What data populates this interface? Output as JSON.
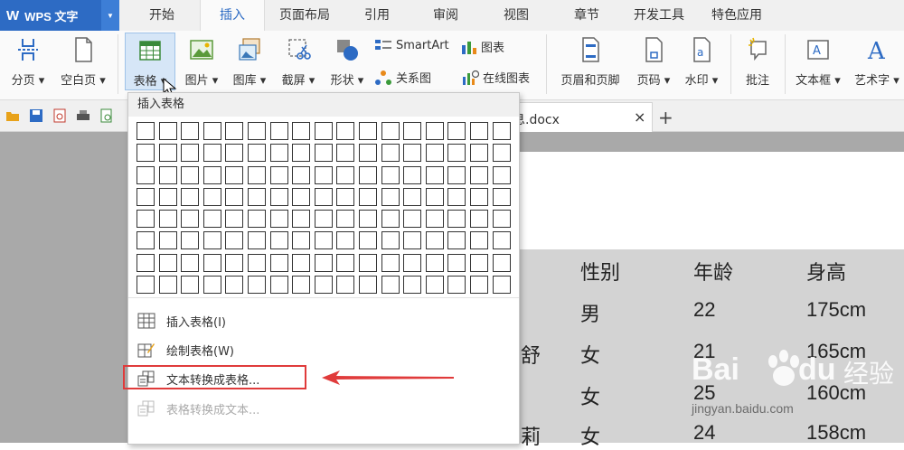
{
  "app": {
    "logo_letter": "W",
    "logo_text": "WPS 文字"
  },
  "tabs": [
    {
      "label": "开始"
    },
    {
      "label": "插入",
      "active": true
    },
    {
      "label": "页面布局"
    },
    {
      "label": "引用"
    },
    {
      "label": "审阅"
    },
    {
      "label": "视图"
    },
    {
      "label": "章节"
    },
    {
      "label": "开发工具"
    },
    {
      "label": "特色应用"
    }
  ],
  "ribbon": {
    "page_break": "分页",
    "blank_page": "空白页",
    "table": "表格",
    "picture": "图片",
    "gallery": "图库",
    "screenshot": "截屏",
    "shapes": "形状",
    "smartart": "SmartArt",
    "chart": "图表",
    "relation": "关系图",
    "online_chart": "在线图表",
    "header_footer": "页眉和页脚",
    "page_number": "页码",
    "watermark": "水印",
    "comment": "批注",
    "textbox": "文本框",
    "wordart": "艺术字"
  },
  "doc_tab": {
    "name": "息.docx",
    "close": "×",
    "add": "+"
  },
  "dropdown": {
    "header": "插入表格",
    "grid_cols": 17,
    "grid_rows": 8,
    "items": [
      {
        "label": "插入表格(I)",
        "disabled": false
      },
      {
        "label": "绘制表格(W)",
        "disabled": false
      },
      {
        "label": "文本转换成表格...",
        "disabled": false
      },
      {
        "label": "表格转换成文本...",
        "disabled": true
      }
    ]
  },
  "document": {
    "headers": [
      "性别",
      "年龄",
      "身高"
    ],
    "rows": [
      {
        "name": "",
        "gender": "男",
        "age": "22",
        "height": "175cm"
      },
      {
        "name": "舒",
        "gender": "女",
        "age": "21",
        "height": "165cm"
      },
      {
        "name": "",
        "gender": "女",
        "age": "25",
        "height": "160cm"
      },
      {
        "name": "莉",
        "gender": "女",
        "age": "24",
        "height": "158cm"
      }
    ]
  },
  "watermark": {
    "brand": "Bai",
    "brand2": "du",
    "cn": "经验",
    "url": "jingyan.baidu.com"
  },
  "colors": {
    "brand_blue": "#2d6bc4",
    "highlight_red": "#e03b3b"
  }
}
